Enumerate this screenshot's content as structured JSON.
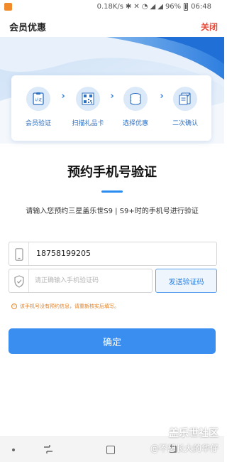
{
  "status_bar": {
    "network_speed": "0.18K/s",
    "battery": "96%",
    "time": "06:48"
  },
  "header": {
    "title": "会员优惠",
    "close_label": "关闭"
  },
  "steps": [
    {
      "label": "会员验证",
      "icon": "id-card-icon",
      "badge": "认证"
    },
    {
      "label": "扫描礼品卡",
      "icon": "qr-code-icon"
    },
    {
      "label": "选择优惠",
      "icon": "coin-stack-icon"
    },
    {
      "label": "二次确认",
      "icon": "document-check-icon"
    }
  ],
  "main": {
    "title": "预约手机号验证",
    "instruction": "请输入您预约三星盖乐世S9 | S9+时的手机号进行验证"
  },
  "form": {
    "phone_value": "18758199205",
    "code_placeholder": "请正确输入手机验证码",
    "send_code_label": "发送验证码",
    "notice_text": "该手机号没有预约信息，请重新核实后填写。",
    "confirm_label": "确定"
  },
  "watermark": {
    "line1": "盖乐世社区",
    "line2": "@不想长大的华仔"
  },
  "colors": {
    "accent": "#3a8ef0",
    "close": "#e64a3b",
    "warning": "#e08126"
  }
}
